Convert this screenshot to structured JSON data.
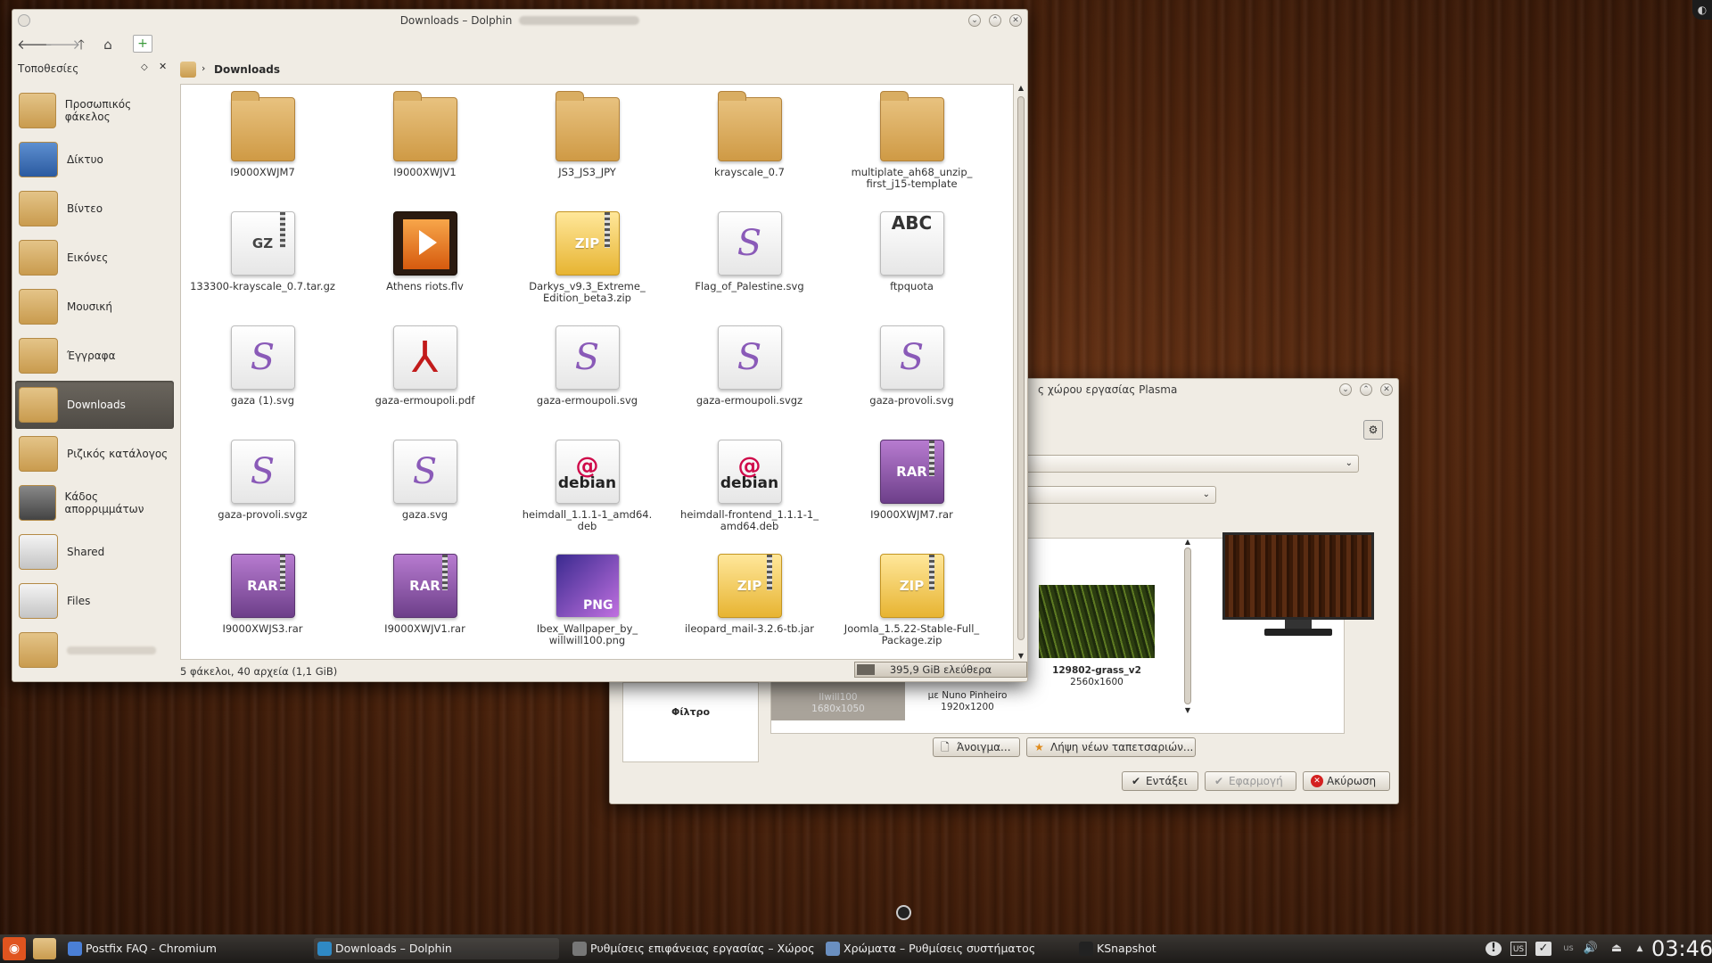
{
  "dolphin": {
    "title": "Downloads – Dolphin",
    "places_title": "Τοποθεσίες",
    "places": [
      {
        "label": "Προσωπικός φάκελος",
        "icon": "home-folder-icon"
      },
      {
        "label": "Δίκτυο",
        "icon": "network-icon"
      },
      {
        "label": "Βίντεο",
        "icon": "video-folder-icon"
      },
      {
        "label": "Εικόνες",
        "icon": "pictures-folder-icon"
      },
      {
        "label": "Μουσική",
        "icon": "music-folder-icon"
      },
      {
        "label": "Έγγραφα",
        "icon": "documents-folder-icon"
      },
      {
        "label": "Downloads",
        "icon": "downloads-folder-icon",
        "selected": true
      },
      {
        "label": "Ριζικός κατάλογος",
        "icon": "root-folder-icon"
      },
      {
        "label": "Κάδος απορριμμάτων",
        "icon": "trash-icon"
      },
      {
        "label": "Shared",
        "icon": "drive-icon"
      },
      {
        "label": "Files",
        "icon": "drive-icon"
      }
    ],
    "breadcrumb": "Downloads",
    "files": [
      {
        "name": "I9000XWJM7",
        "type": "folder"
      },
      {
        "name": "I9000XWJV1",
        "type": "folder"
      },
      {
        "name": "JS3_JS3_JPY",
        "type": "folder"
      },
      {
        "name": "krayscale_0.7",
        "type": "folder"
      },
      {
        "name": "multiplate_ah68_unzip_\nfirst_j15-template",
        "type": "folder"
      },
      {
        "name": "133300-krayscale_0.7.tar.gz",
        "type": "gz"
      },
      {
        "name": "Athens riots.flv",
        "type": "flv"
      },
      {
        "name": "Darkys_v9.3_Extreme_\nEdition_beta3.zip",
        "type": "zip"
      },
      {
        "name": "Flag_of_Palestine.svg",
        "type": "svg"
      },
      {
        "name": "ftpquota",
        "type": "text"
      },
      {
        "name": "gaza (1).svg",
        "type": "svg"
      },
      {
        "name": "gaza-ermoupoli.pdf",
        "type": "pdf"
      },
      {
        "name": "gaza-ermoupoli.svg",
        "type": "svg"
      },
      {
        "name": "gaza-ermoupoli.svgz",
        "type": "svg"
      },
      {
        "name": "gaza-provoli.svg",
        "type": "svg"
      },
      {
        "name": "gaza-provoli.svgz",
        "type": "svg"
      },
      {
        "name": "gaza.svg",
        "type": "svg"
      },
      {
        "name": "heimdall_1.1.1-1_amd64.\ndeb",
        "type": "deb"
      },
      {
        "name": "heimdall-frontend_1.1.1-1_\namd64.deb",
        "type": "deb"
      },
      {
        "name": "I9000XWJM7.rar",
        "type": "rar"
      },
      {
        "name": "I9000XWJS3.rar",
        "type": "rar"
      },
      {
        "name": "I9000XWJV1.rar",
        "type": "rar"
      },
      {
        "name": "Ibex_Wallpaper_by_\nwillwill100.png",
        "type": "png"
      },
      {
        "name": "ileopard_mail-3.2.6-tb.jar",
        "type": "zip"
      },
      {
        "name": "Joomla_1.5.22-Stable-Full_\nPackage.zip",
        "type": "zip"
      }
    ],
    "icon_labels": {
      "gz": "GZ",
      "zip": "ZIP",
      "rar": "RAR",
      "svg": "S",
      "deb": "debian",
      "deb_swirl": "@",
      "pdf": "⅄",
      "png": "PNG",
      "text": "ABC"
    },
    "status": "5 φάκελοι, 40 αρχεία (1,1 GiB)",
    "free_space": "395,9 GiB ελεύθερα"
  },
  "settings": {
    "title": "ς χώρου εργασίας Plasma",
    "filter_label": "Φίλτρο",
    "wallpaper_left_line1": "llwill100",
    "wallpaper_left_line2": "1680x1050",
    "wallpaper_mid_line1": "με Nuno Pinheiro",
    "wallpaper_mid_line2": "1920x1200",
    "wallpaper_name": "129802-grass_v2",
    "wallpaper_res": "2560x1600",
    "open_button": "Άνοιγμα...",
    "get_new_button": "Λήψη νέων ταπετσαριών...",
    "ok_button": "Εντάξει",
    "apply_button": "Εφαρμογή",
    "cancel_button": "Ακύρωση"
  },
  "taskbar": {
    "tasks": [
      {
        "label": "Postfix FAQ - Chromium",
        "active": false
      },
      {
        "label": "Downloads – Dolphin",
        "active": true
      },
      {
        "label": "Ρυθμίσεις επιφάνειας εργασίας – Χώρος εργασ",
        "active": false
      },
      {
        "label": "Χρώματα – Ρυθμίσεις συστήματος",
        "active": false
      },
      {
        "label": "KSnapshot",
        "active": false
      }
    ],
    "clock": "03:46",
    "keyboard": "US"
  },
  "colors": {
    "accent": "#d39f4e",
    "selection": "#5c5750",
    "taskbar": "#2a2724"
  }
}
